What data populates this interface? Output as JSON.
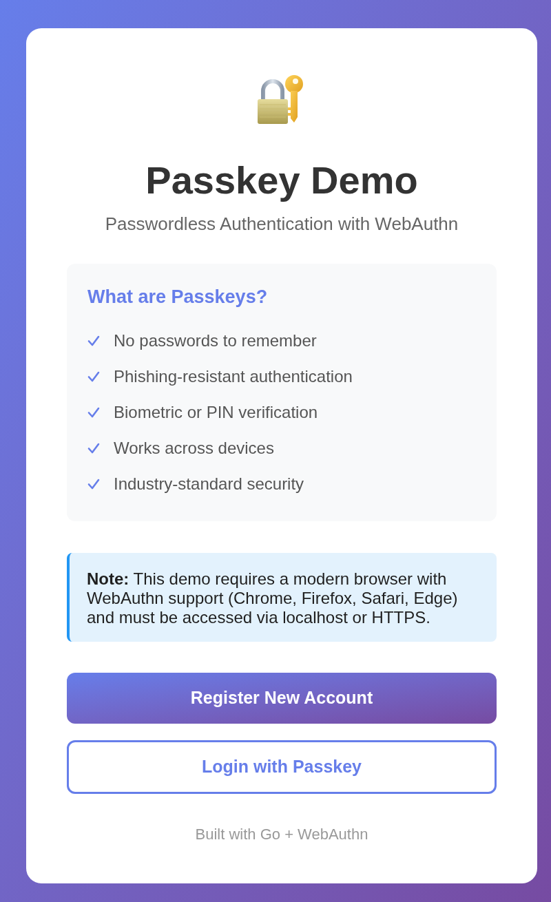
{
  "header": {
    "title": "Passkey Demo",
    "subtitle": "Passwordless Authentication with WebAuthn"
  },
  "info_box": {
    "heading": "What are Passkeys?",
    "items": [
      "No passwords to remember",
      "Phishing-resistant authentication",
      "Biometric or PIN verification",
      "Works across devices",
      "Industry-standard security"
    ]
  },
  "note": {
    "text": "**Note:** This demo requires a modern browser with WebAuthn support (Chrome, Firefox, Safari, Edge) and must be accessed via localhost or HTTPS."
  },
  "buttons": [
    {
      "label": "Register New Account",
      "kind": "primary"
    },
    {
      "label": "Login with Passkey",
      "kind": "secondary"
    }
  ],
  "footer": "Built with Go + WebAuthn"
}
